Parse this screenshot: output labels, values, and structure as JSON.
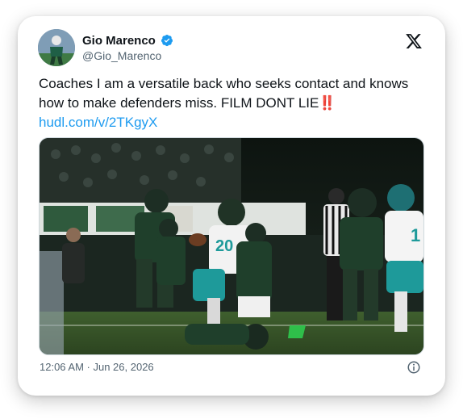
{
  "author": {
    "display_name": "Gio Marenco",
    "handle": "@Gio_Marenco",
    "verified": true
  },
  "tweet": {
    "text": "Coaches I am a versatile back who seeks contact and knows how to make defenders miss. FILM DONT LIE",
    "emoji": "‼️",
    "link": "hudl.com/v/2TKgyX",
    "timestamp": "12:06 AM · Jun 26, 2026"
  },
  "icons": {
    "brand": "x-logo-icon",
    "verified": "verified-badge-icon",
    "info": "info-icon"
  },
  "colors": {
    "link": "#1d9bf0",
    "verified": "#1d9bf0",
    "text": "#0f1419",
    "muted": "#536471",
    "team_green": "#1f3f2b",
    "team_teal": "#1e9a9a"
  }
}
